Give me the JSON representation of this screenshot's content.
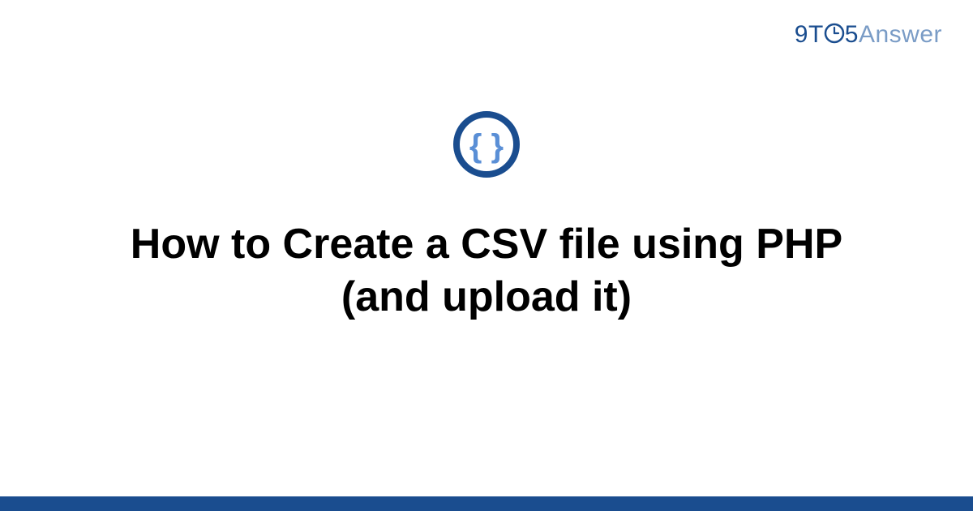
{
  "brand": {
    "part1": "9",
    "part2": "T",
    "part3": "5",
    "part4": "Answer"
  },
  "badge": {
    "name": "curly-braces-icon"
  },
  "title": "How to Create a CSV file using PHP (and upload it)",
  "colors": {
    "brand_dark": "#1a4d8f",
    "brand_light": "#7a9cc6",
    "badge_ring": "#1a4d8f",
    "badge_glyph": "#5a8fd6"
  }
}
